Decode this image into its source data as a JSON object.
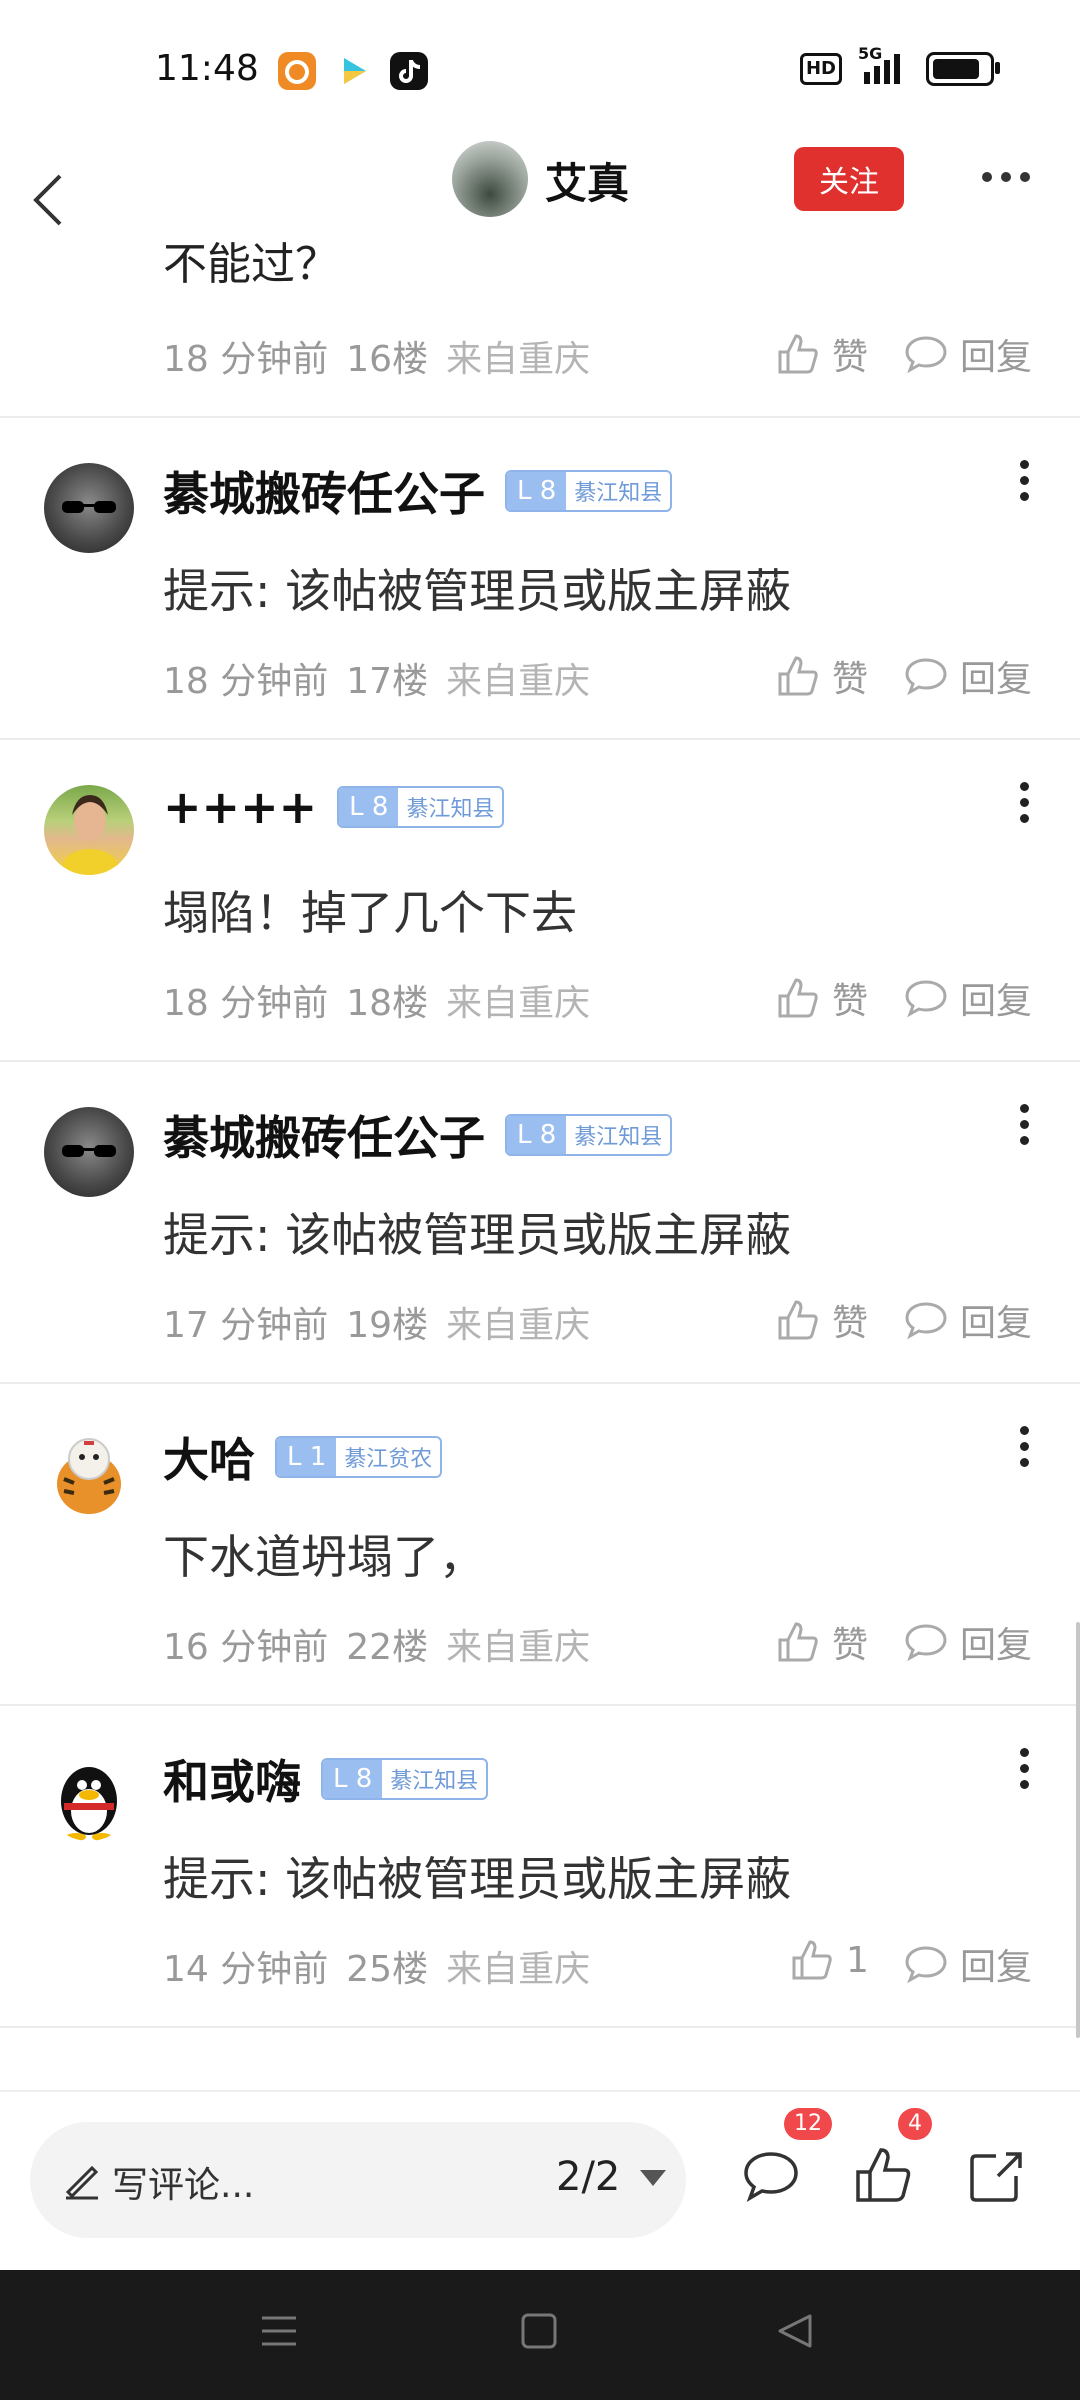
{
  "status_bar": {
    "time": "11:48",
    "hd": "HD",
    "network": "5G",
    "battery_level": 0.85,
    "apps": [
      "uc-browser-icon",
      "video-play-icon",
      "tiktok-icon"
    ]
  },
  "nav": {
    "author_name": "艾真",
    "follow_label": "关注"
  },
  "partial": {
    "text": "不能过？",
    "time": "18 分钟前",
    "floor": "16楼",
    "location": "来自重庆",
    "like_label": "赞",
    "reply_label": "回复"
  },
  "comments": [
    {
      "name": "綦城搬砖任公子",
      "level": "L 8",
      "level_title": "綦江知县",
      "text": "提示: 该帖被管理员或版主屏蔽",
      "time": "18 分钟前",
      "floor": "17楼",
      "location": "来自重庆",
      "like_label": "赞",
      "reply_label": "回复"
    },
    {
      "name": "++++",
      "level": "L 8",
      "level_title": "綦江知县",
      "text": "塌陷！掉了几个下去",
      "time": "18 分钟前",
      "floor": "18楼",
      "location": "来自重庆",
      "like_label": "赞",
      "reply_label": "回复"
    },
    {
      "name": "綦城搬砖任公子",
      "level": "L 8",
      "level_title": "綦江知县",
      "text": "提示: 该帖被管理员或版主屏蔽",
      "time": "17 分钟前",
      "floor": "19楼",
      "location": "来自重庆",
      "like_label": "赞",
      "reply_label": "回复"
    },
    {
      "name": "大哈",
      "level": "L 1",
      "level_title": "綦江贫农",
      "text": "下水道坍塌了，",
      "time": "16 分钟前",
      "floor": "22楼",
      "location": "来自重庆",
      "like_label": "赞",
      "reply_label": "回复"
    },
    {
      "name": "和或嗨",
      "level": "L 8",
      "level_title": "綦江知县",
      "text": "提示: 该帖被管理员或版主屏蔽",
      "time": "14 分钟前",
      "floor": "25楼",
      "location": "来自重庆",
      "like_label": "1",
      "reply_label": "回复"
    }
  ],
  "bottom_bar": {
    "input_placeholder": "写评论...",
    "pager": "2/2",
    "comment_count": "12",
    "like_count": "4"
  },
  "colors": {
    "follow_bg": "#e0312e",
    "badge_bg": "#f0484b",
    "level_blue": "#9bbef0",
    "meta_gray": "#999999"
  }
}
